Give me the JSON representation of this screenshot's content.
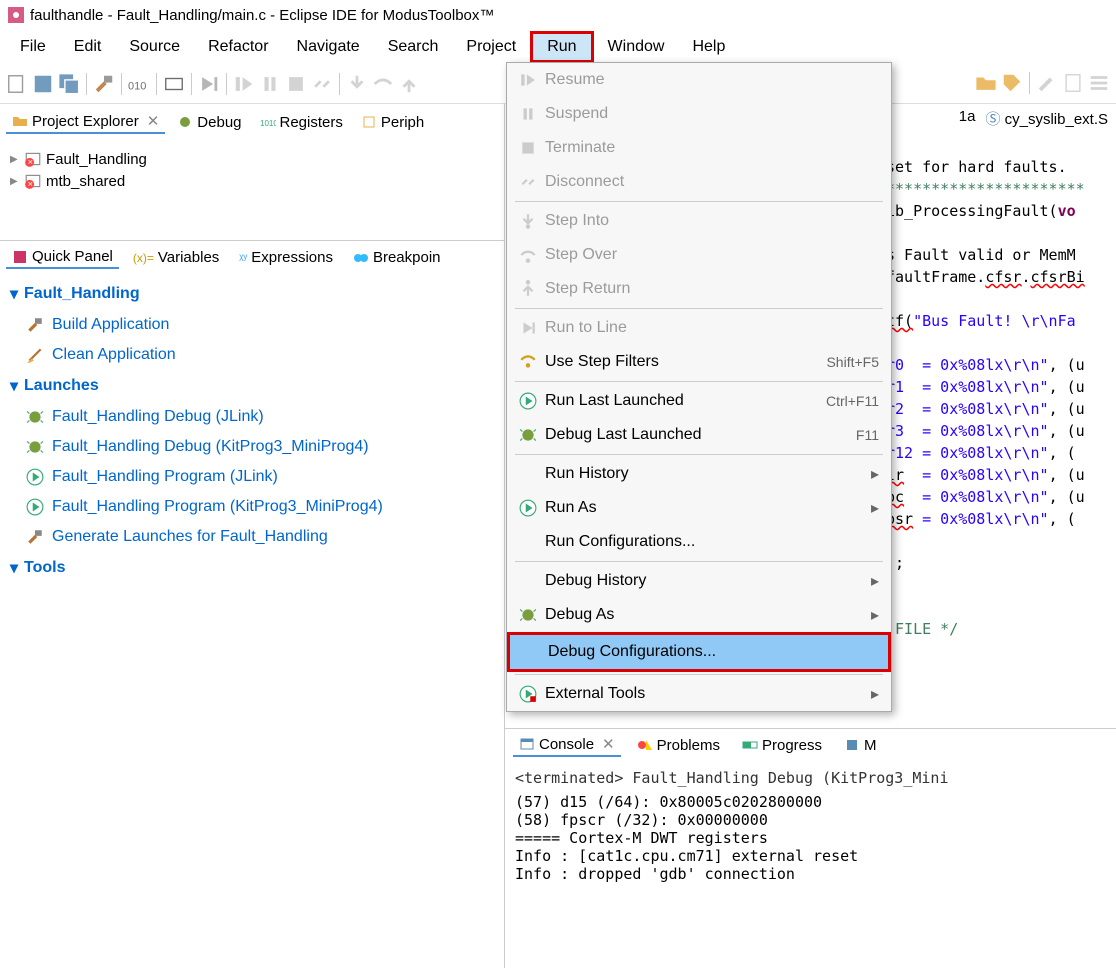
{
  "title": "faulthandle - Fault_Handling/main.c - Eclipse IDE for ModusToolbox™",
  "menubar": [
    "File",
    "Edit",
    "Source",
    "Refactor",
    "Navigate",
    "Search",
    "Project",
    "Run",
    "Window",
    "Help"
  ],
  "menubar_highlight_index": 7,
  "views": {
    "project_explorer": "Project Explorer",
    "debug": "Debug",
    "registers": "Registers",
    "peripherals": "Periph"
  },
  "projects": [
    {
      "name": "Fault_Handling"
    },
    {
      "name": "mtb_shared"
    }
  ],
  "quick_tabs": [
    "Quick Panel",
    "Variables",
    "Expressions",
    "Breakpoin"
  ],
  "qp": {
    "heading1": "Fault_Handling",
    "build": "Build Application",
    "clean": "Clean Application",
    "heading2": "Launches",
    "l1": "Fault_Handling Debug (JLink)",
    "l2": "Fault_Handling Debug (KitProg3_MiniProg4)",
    "l3": "Fault_Handling Program (JLink)",
    "l4": "Fault_Handling Program (KitProg3_MiniProg4)",
    "l5": "Generate Launches for Fault_Handling",
    "heading3": "Tools"
  },
  "run_menu": {
    "resume": "Resume",
    "suspend": "Suspend",
    "terminate": "Terminate",
    "disconnect": "Disconnect",
    "step_into": "Step Into",
    "step_over": "Step Over",
    "step_return": "Step Return",
    "run_to_line": "Run to Line",
    "use_step_filters": "Use Step Filters",
    "use_step_filters_sc": "Shift+F5",
    "run_last": "Run Last Launched",
    "run_last_sc": "Ctrl+F11",
    "debug_last": "Debug Last Launched",
    "debug_last_sc": "F11",
    "run_history": "Run History",
    "run_as": "Run As",
    "run_config": "Run Configurations...",
    "debug_history": "Debug History",
    "debug_as": "Debug As",
    "debug_config": "Debug Configurations...",
    "external": "External Tools"
  },
  "editor_tabs": {
    "t1": "1a",
    "t2": "cy_syslib_ext.S"
  },
  "code": {
    "l1": "set for hard faults.",
    "l2": "**********************",
    "l3a": "ib_ProcessingFault(",
    "l3b": "vo",
    "l4": "s Fault valid or MemM",
    "l5a": "faultFrame.",
    "l5b": "cfsr",
    "l5c": ".",
    "l5d": "cfsrBi",
    "l6a": "tf(",
    "l6b": "\"Bus Fault! \\r\\nFa",
    "l7a": "r0  = 0x%08lx\\r\\n\"",
    "l7b": ", (u",
    "l8": "r1  = 0x%08lx\\r\\n\"",
    "l9": "r2  = 0x%08lx\\r\\n\"",
    "l10": "r3  = 0x%08lx\\r\\n\"",
    "l11a": "r12 = 0x%08lx\\r\\n\"",
    "l11b": ", (",
    "l12a": "lr",
    "l12b": "  = 0x%08lx\\r\\n\"",
    "l13a": "pc",
    "l13b": "  = 0x%08lx\\r\\n\"",
    "l14a": "psr",
    "l14b": " = 0x%08lx\\r\\n\"",
    "l14c": ", (",
    "l15": ");",
    "l16": " FILE */"
  },
  "console": {
    "tabs": [
      "Console",
      "Problems",
      "Progress",
      "M"
    ],
    "title": "<terminated> Fault_Handling Debug (KitProg3_Mini",
    "lines": [
      "(57) d15 (/64): 0x80005c0202800000",
      "(58) fpscr (/32): 0x00000000",
      "===== Cortex-M DWT registers",
      "Info : [cat1c.cpu.cm71] external reset ",
      "Info : dropped 'gdb' connection"
    ]
  }
}
